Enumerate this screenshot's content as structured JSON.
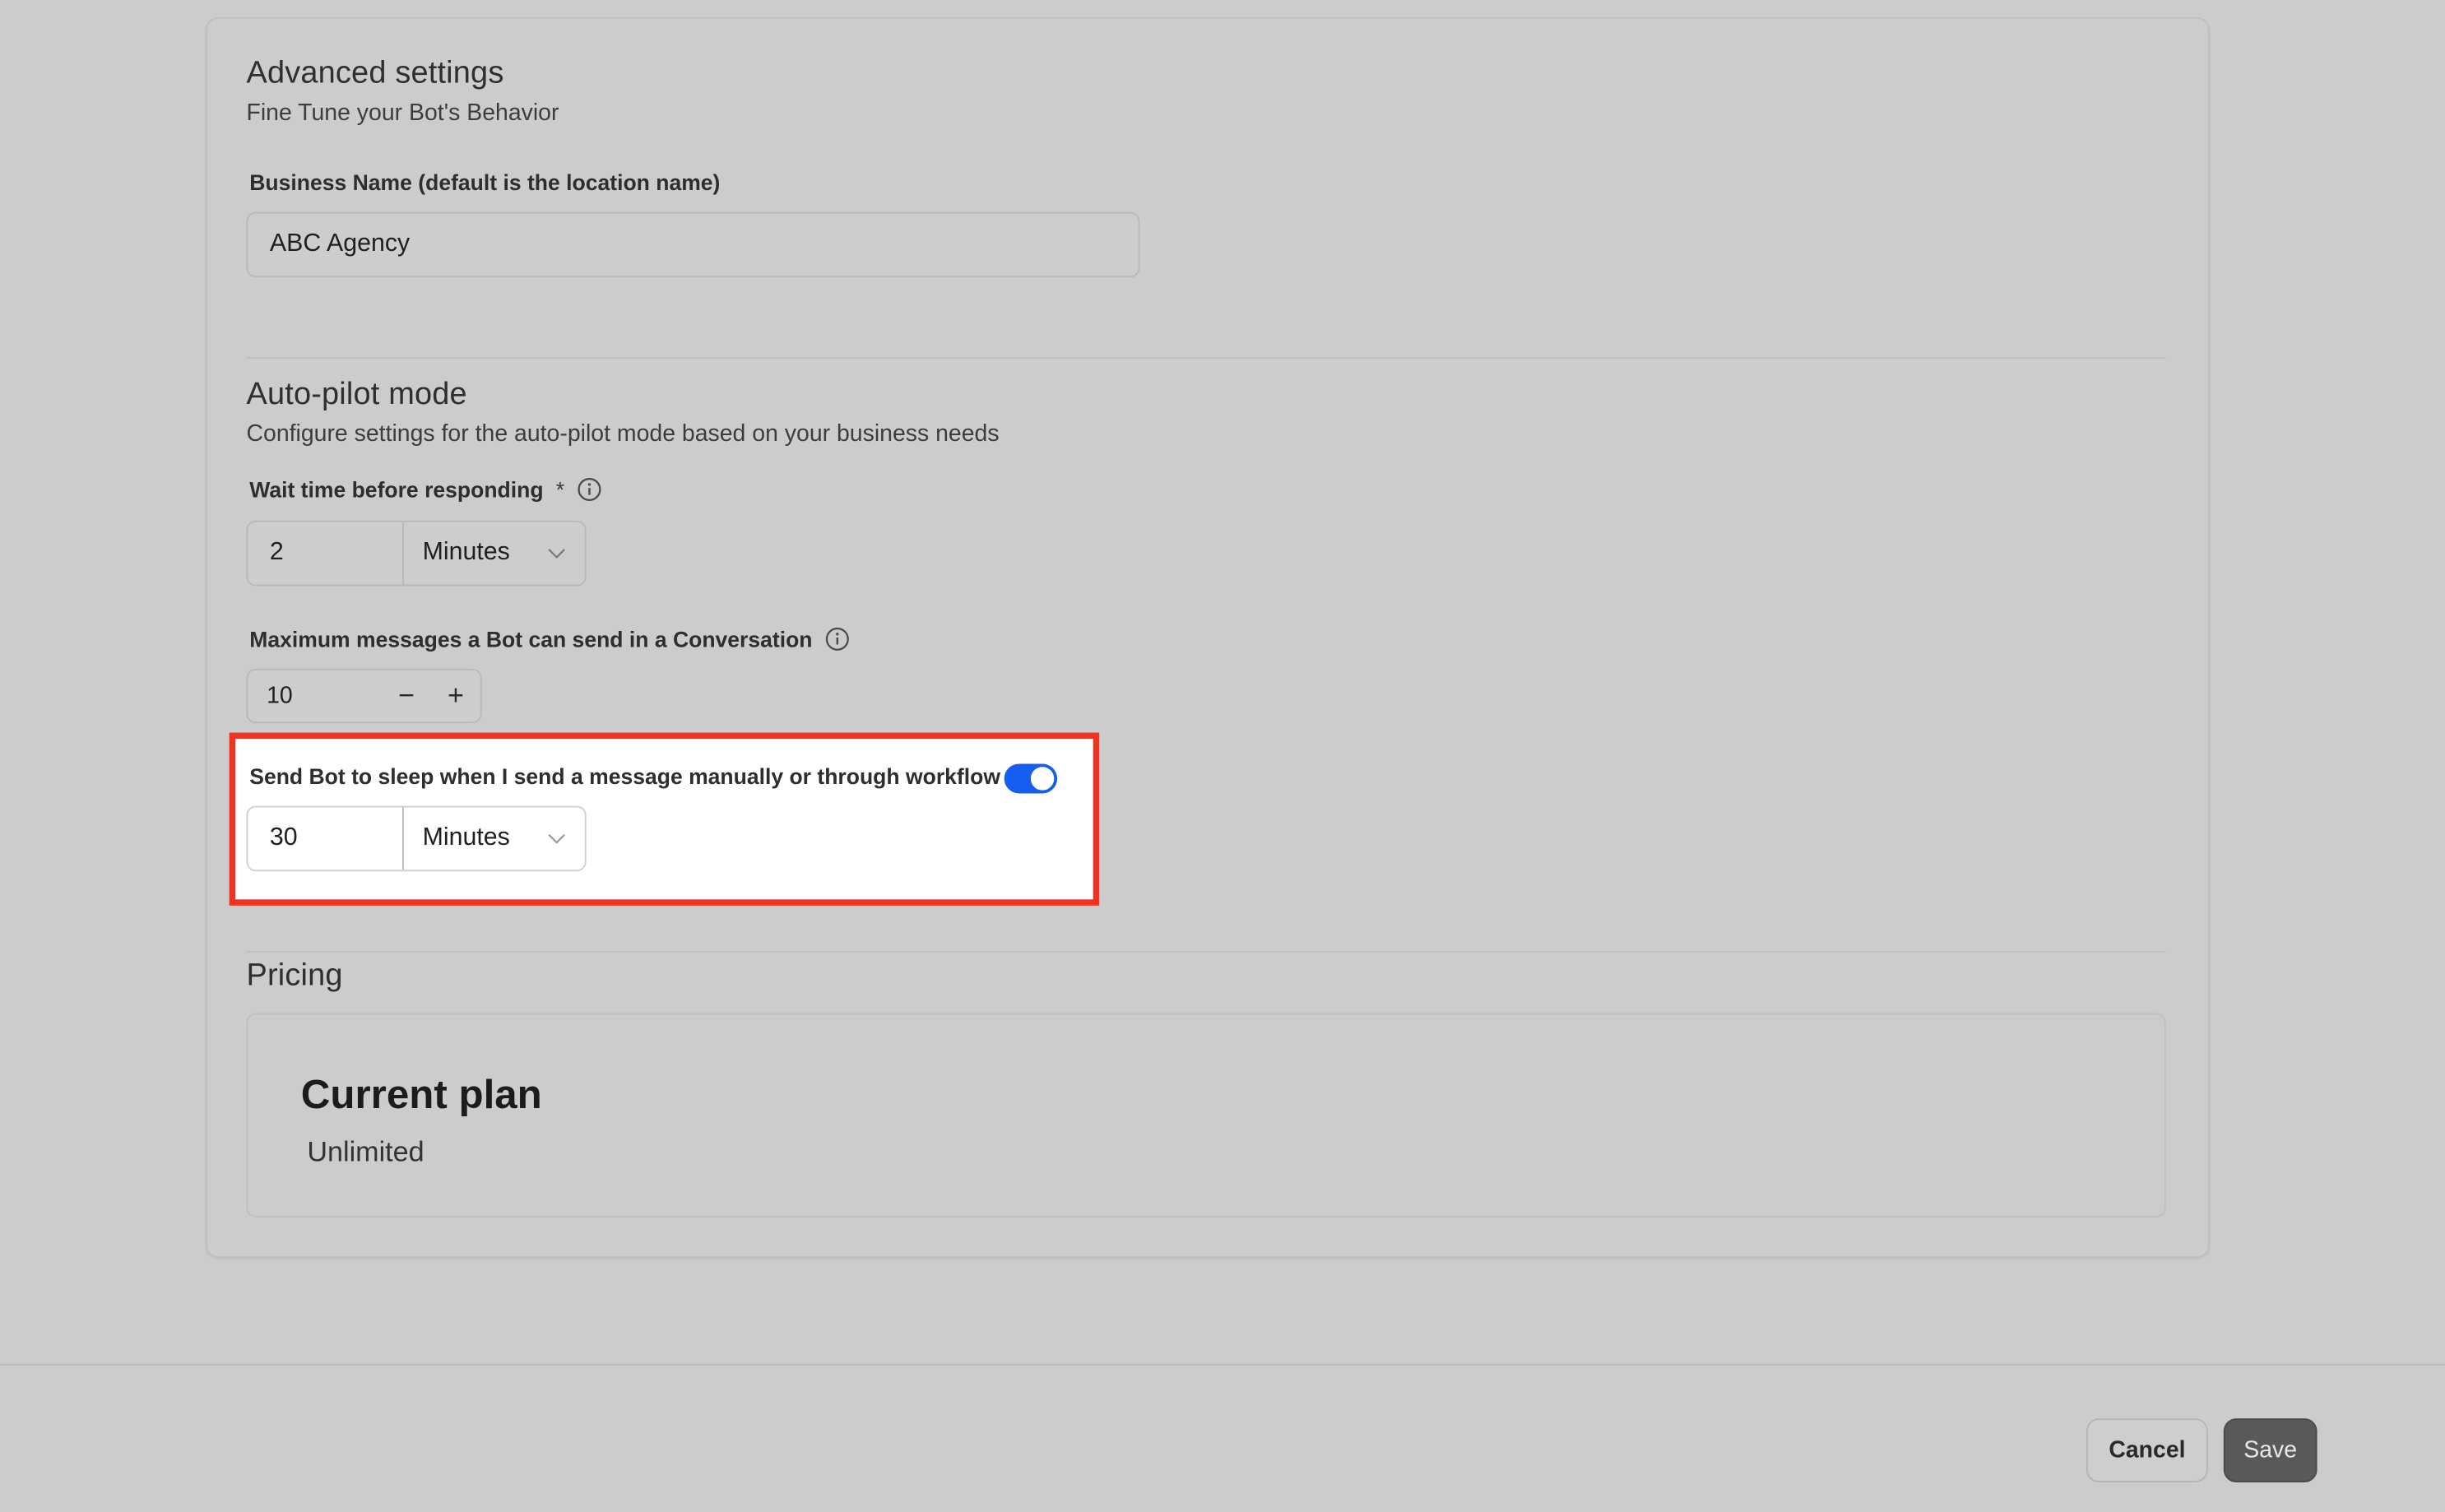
{
  "advanced": {
    "title": "Advanced settings",
    "subtitle": "Fine Tune your Bot's Behavior",
    "business_name_label": "Business Name (default is the location name)",
    "business_name_value": "ABC Agency"
  },
  "autopilot": {
    "title": "Auto-pilot mode",
    "subtitle": "Configure settings for the auto-pilot mode based on your business needs",
    "wait_label": "Wait time before responding",
    "wait_required": "*",
    "wait_value": "2",
    "wait_unit": "Minutes",
    "max_label": "Maximum messages a Bot can send in a Conversation",
    "max_value": "10",
    "minus": "−",
    "plus": "+",
    "sleep_label": "Send Bot to sleep when I send a message manually or through workflow",
    "sleep_enabled": true,
    "sleep_value": "30",
    "sleep_unit": "Minutes"
  },
  "pricing": {
    "title": "Pricing",
    "plan_title": "Current plan",
    "plan_value": "Unlimited"
  },
  "footer": {
    "cancel": "Cancel",
    "save": "Save"
  },
  "colors": {
    "accent": "#155eef",
    "highlight": "#f2321f",
    "background": "#cccccc"
  }
}
